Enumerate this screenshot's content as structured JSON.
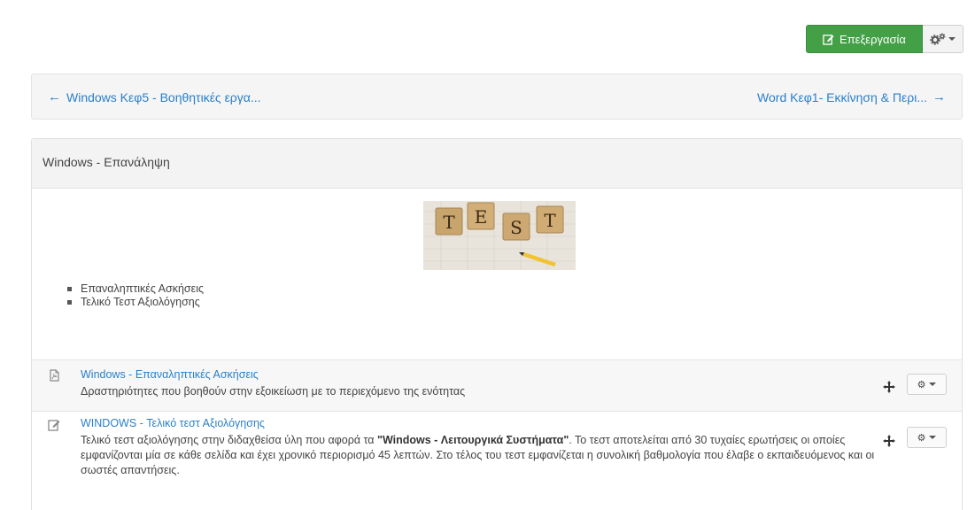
{
  "toolbar": {
    "edit_label": "Επεξεργασία",
    "edit_icon": "edit-icon",
    "settings_icon": "gears-icon",
    "accent": "#43a047"
  },
  "navigation": {
    "prev_label": "Windows Κεφ5 - Βοηθητικές εργα...",
    "next_label": "Word Κεφ1- Εκκίνηση & Περι...",
    "link_color": "#2a7fc9"
  },
  "section": {
    "title": "Windows - Επανάληψη",
    "image_letters": [
      "T",
      "E",
      "S",
      "T"
    ],
    "summary_items": [
      "Επαναληπτικές Ασκήσεις",
      "Τελικό Τεστ Αξιολόγησης"
    ]
  },
  "activities": [
    {
      "icon": "pdf-file-icon",
      "title": "Windows - Επαναληπτικές Ασκήσεις",
      "description": "Δραστηριότητες που βοηθούν στην εξοικείωση με το περιεχόμενο της ενότητας"
    },
    {
      "icon": "edit-icon",
      "title": "WINDOWS - Τελικό τεστ Αξιολόγησης",
      "description_before": "Τελικό τεστ αξιολόγησης στην διδαχθείσα ύλη που αφορά τα ",
      "description_bold": "\"Windows - Λειτουργικά Συστήματα\"",
      "description_after": ". Το τεστ αποτελείται από 30 τυχαίες ερωτήσεις οι οποίες εμφανίζονται μία σε κάθε σελίδα και έχει χρονικό περιορισμό 45 λεπτών. Στο τέλος του τεστ εμφανίζεται η συνολική βαθμολογία που έλαβε ο εκπαιδευόμενος και οι σωστές απαντήσεις."
    }
  ]
}
